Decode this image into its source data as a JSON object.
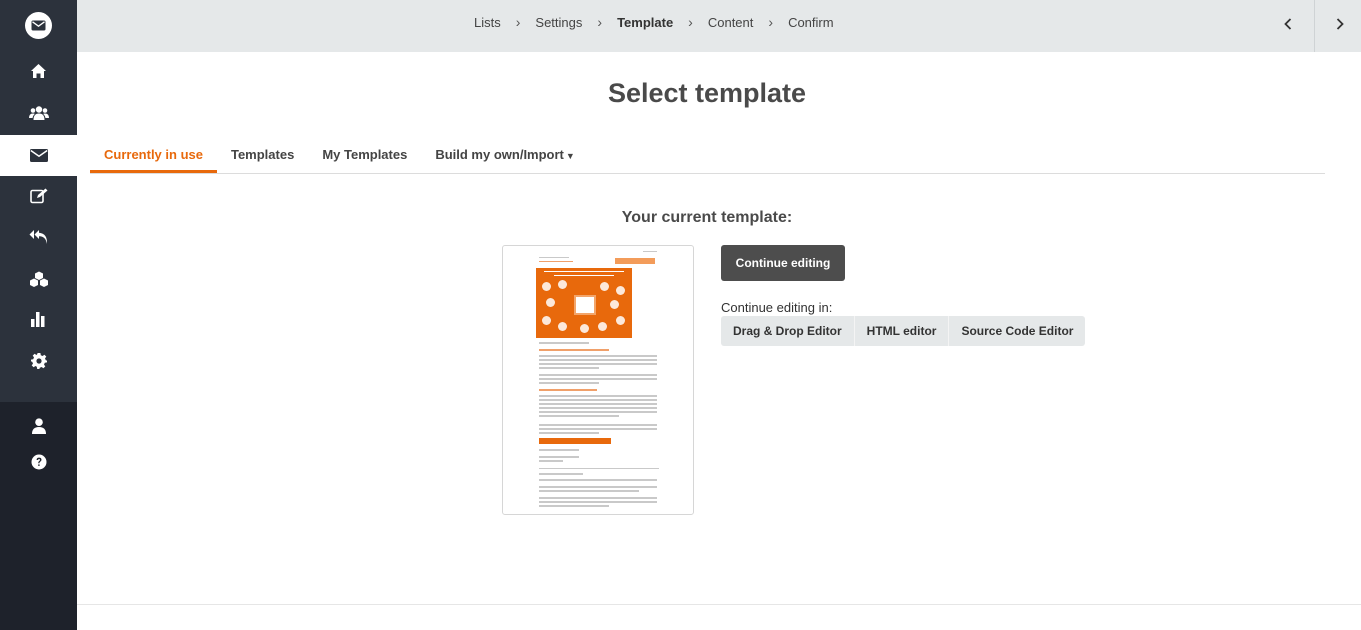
{
  "sidebar": {
    "logo_icon": "envelope-logo-icon",
    "items": [
      {
        "name": "home",
        "icon": "home-icon",
        "active": false
      },
      {
        "name": "recipients",
        "icon": "users-icon",
        "active": false
      },
      {
        "name": "mailings",
        "icon": "envelope-icon",
        "active": true
      },
      {
        "name": "forms",
        "icon": "edit-icon",
        "active": false
      },
      {
        "name": "autoresponders",
        "icon": "reply-all-icon",
        "active": false
      },
      {
        "name": "integrations",
        "icon": "cubes-icon",
        "active": false
      },
      {
        "name": "reports",
        "icon": "bar-chart-icon",
        "active": false
      },
      {
        "name": "settings",
        "icon": "gear-icon",
        "active": false
      }
    ],
    "bottom_items": [
      {
        "name": "account",
        "icon": "user-icon"
      },
      {
        "name": "help",
        "icon": "question-circle-icon"
      }
    ]
  },
  "breadcrumb": {
    "steps": [
      "Lists",
      "Settings",
      "Template",
      "Content",
      "Confirm"
    ],
    "active": "Template",
    "separator": ">"
  },
  "page": {
    "title": "Select template"
  },
  "tabs": [
    {
      "label": "Currently in use",
      "active": true
    },
    {
      "label": "Templates",
      "active": false
    },
    {
      "label": "My Templates",
      "active": false
    },
    {
      "label": "Build my own/Import",
      "active": false,
      "dropdown": true
    }
  ],
  "current_template": {
    "heading": "Your current template:",
    "continue_button": "Continue editing",
    "continue_in_label": "Continue editing in:",
    "editors": [
      "Drag & Drop Editor",
      "HTML editor",
      "Source Code Editor"
    ]
  },
  "colors": {
    "accent": "#e8690c",
    "sidebar_bg": "#2c323c",
    "topbar_bg": "#e5e8e9",
    "button_dark": "#4d4d4d"
  }
}
